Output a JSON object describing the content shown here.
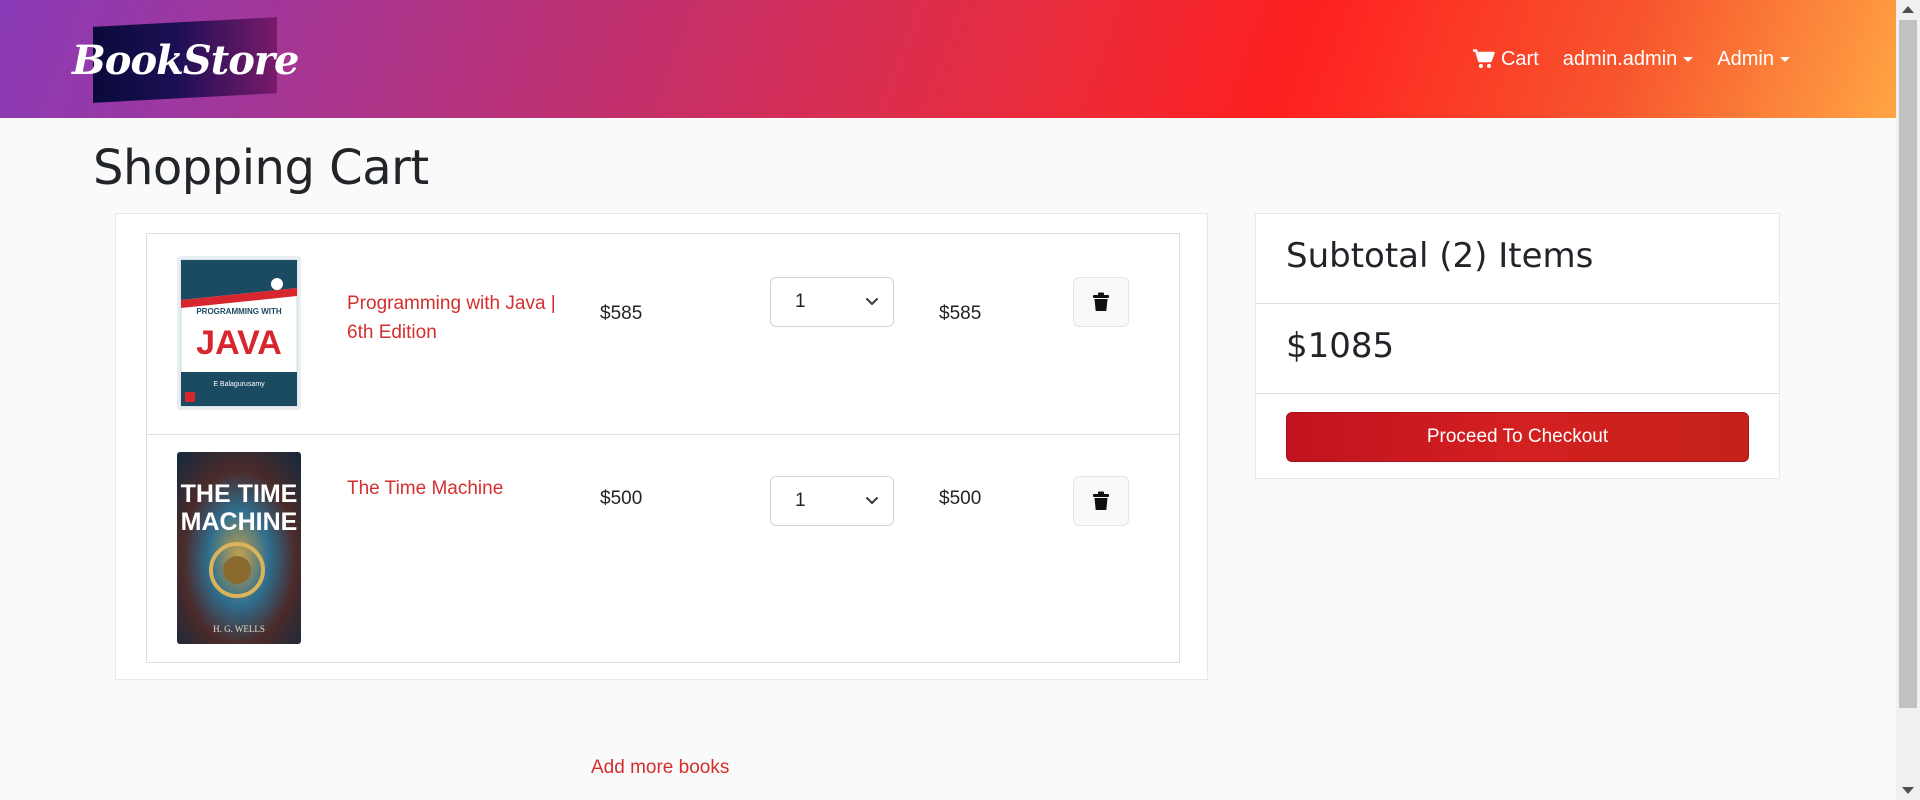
{
  "brand": {
    "logo_text": "BookStore"
  },
  "nav": {
    "cart_label": "Cart",
    "user_menu_label": "admin.admin",
    "admin_menu_label": "Admin"
  },
  "page": {
    "title": "Shopping Cart"
  },
  "cart": {
    "items": [
      {
        "title": "Programming with Java | 6th Edition",
        "price": "$585",
        "quantity": "1",
        "line_total": "$585",
        "cover_text": {
          "line1": "PROGRAMMING WITH",
          "line2": "JAVA",
          "author": "E Balagurusamy"
        }
      },
      {
        "title": "The Time Machine",
        "price": "$500",
        "quantity": "1",
        "line_total": "$500",
        "cover_text": {
          "line1": "THE TIME",
          "line2": "MACHINE",
          "author": "H. G. WELLS"
        }
      }
    ]
  },
  "summary": {
    "heading": "Subtotal (2) Items",
    "amount": "$1085",
    "checkout_label": "Proceed To Checkout"
  },
  "footer": {
    "add_more_label": "Add more books"
  },
  "colors": {
    "accent": "#d32f2f",
    "checkout": "#c91d1d"
  },
  "icons": {
    "cart": "shopping-cart-icon",
    "delete": "trash-icon",
    "dropdown": "chevron-down-icon"
  }
}
